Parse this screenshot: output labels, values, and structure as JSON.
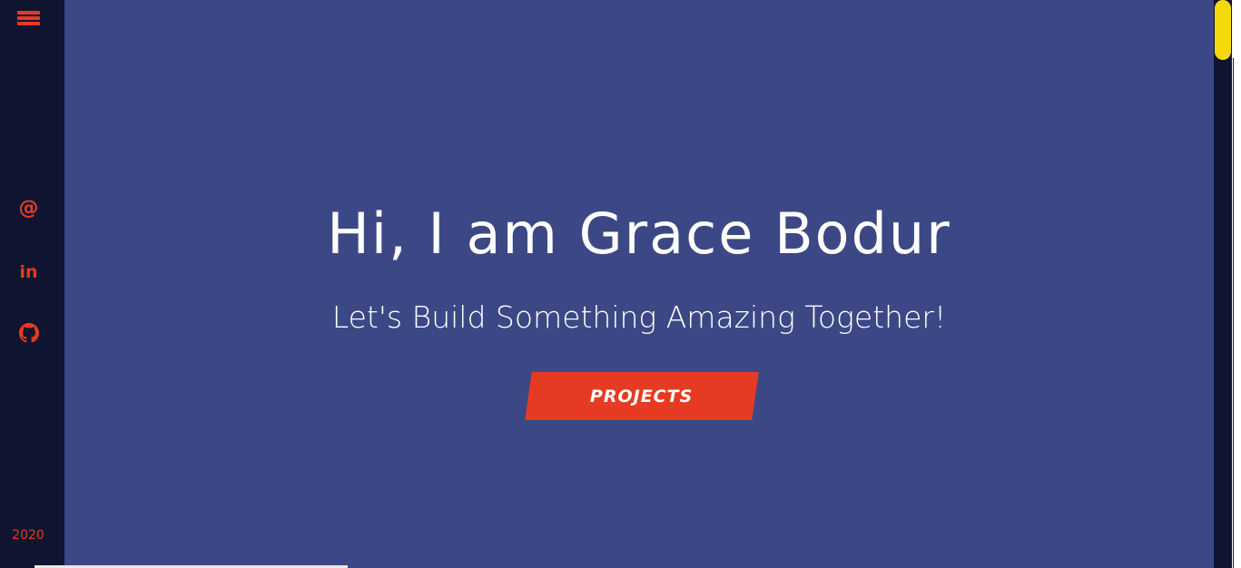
{
  "sidebar": {
    "menu_icon": "hamburger-menu-icon",
    "social": [
      {
        "name": "email",
        "icon": "at-sign-icon",
        "glyph": "@"
      },
      {
        "name": "linkedin",
        "icon": "linkedin-icon",
        "glyph": "in"
      },
      {
        "name": "github",
        "icon": "github-icon",
        "glyph": ""
      }
    ],
    "year": "2020"
  },
  "hero": {
    "title": "Hi, I am Grace Bodur",
    "subtitle": "Let's Build Something Amazing Together!",
    "cta_label": "PROJECTS"
  },
  "colors": {
    "sidebar_bg": "#0f1530",
    "hero_bg": "#3c4885",
    "accent": "#e63b22",
    "text": "#ffffff",
    "scroll_thumb": "#f5d90a"
  }
}
